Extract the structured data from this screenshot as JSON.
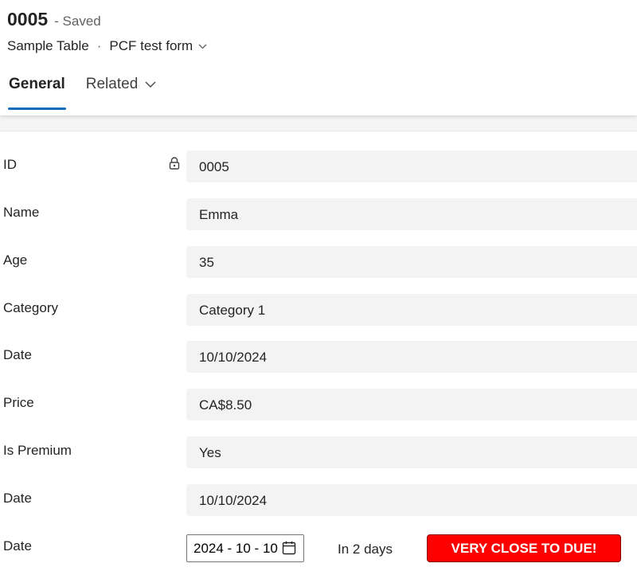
{
  "record": {
    "title": "0005",
    "status": "- Saved"
  },
  "breadcrumb": {
    "entity": "Sample Table",
    "separator": "·",
    "form_name": "PCF test form"
  },
  "tabs": [
    {
      "label": "General",
      "selected": true
    },
    {
      "label": "Related",
      "selected": false
    }
  ],
  "fields": [
    {
      "label": "ID",
      "value": "0005",
      "locked": true
    },
    {
      "label": "Name",
      "value": "Emma"
    },
    {
      "label": "Age",
      "value": "35"
    },
    {
      "label": "Category",
      "value": "Category 1"
    },
    {
      "label": "Date",
      "value": "10/10/2024"
    },
    {
      "label": "Price",
      "value": "CA$8.50"
    },
    {
      "label": "Is Premium",
      "value": "Yes"
    },
    {
      "label": "Date",
      "value": "10/10/2024"
    }
  ],
  "due_control": {
    "label": "Date",
    "date_value": "2024 - 10 - 10",
    "relative_text": "In 2 days",
    "badge_text": "VERY CLOSE TO DUE!"
  },
  "icons": {
    "lock": "lock-icon",
    "chevron": "chevron-down-icon",
    "calendar": "calendar-icon"
  },
  "colors": {
    "accent": "#0f6cbd",
    "field_bg": "#f3f3f3",
    "badge_bg": "#ff0000"
  }
}
